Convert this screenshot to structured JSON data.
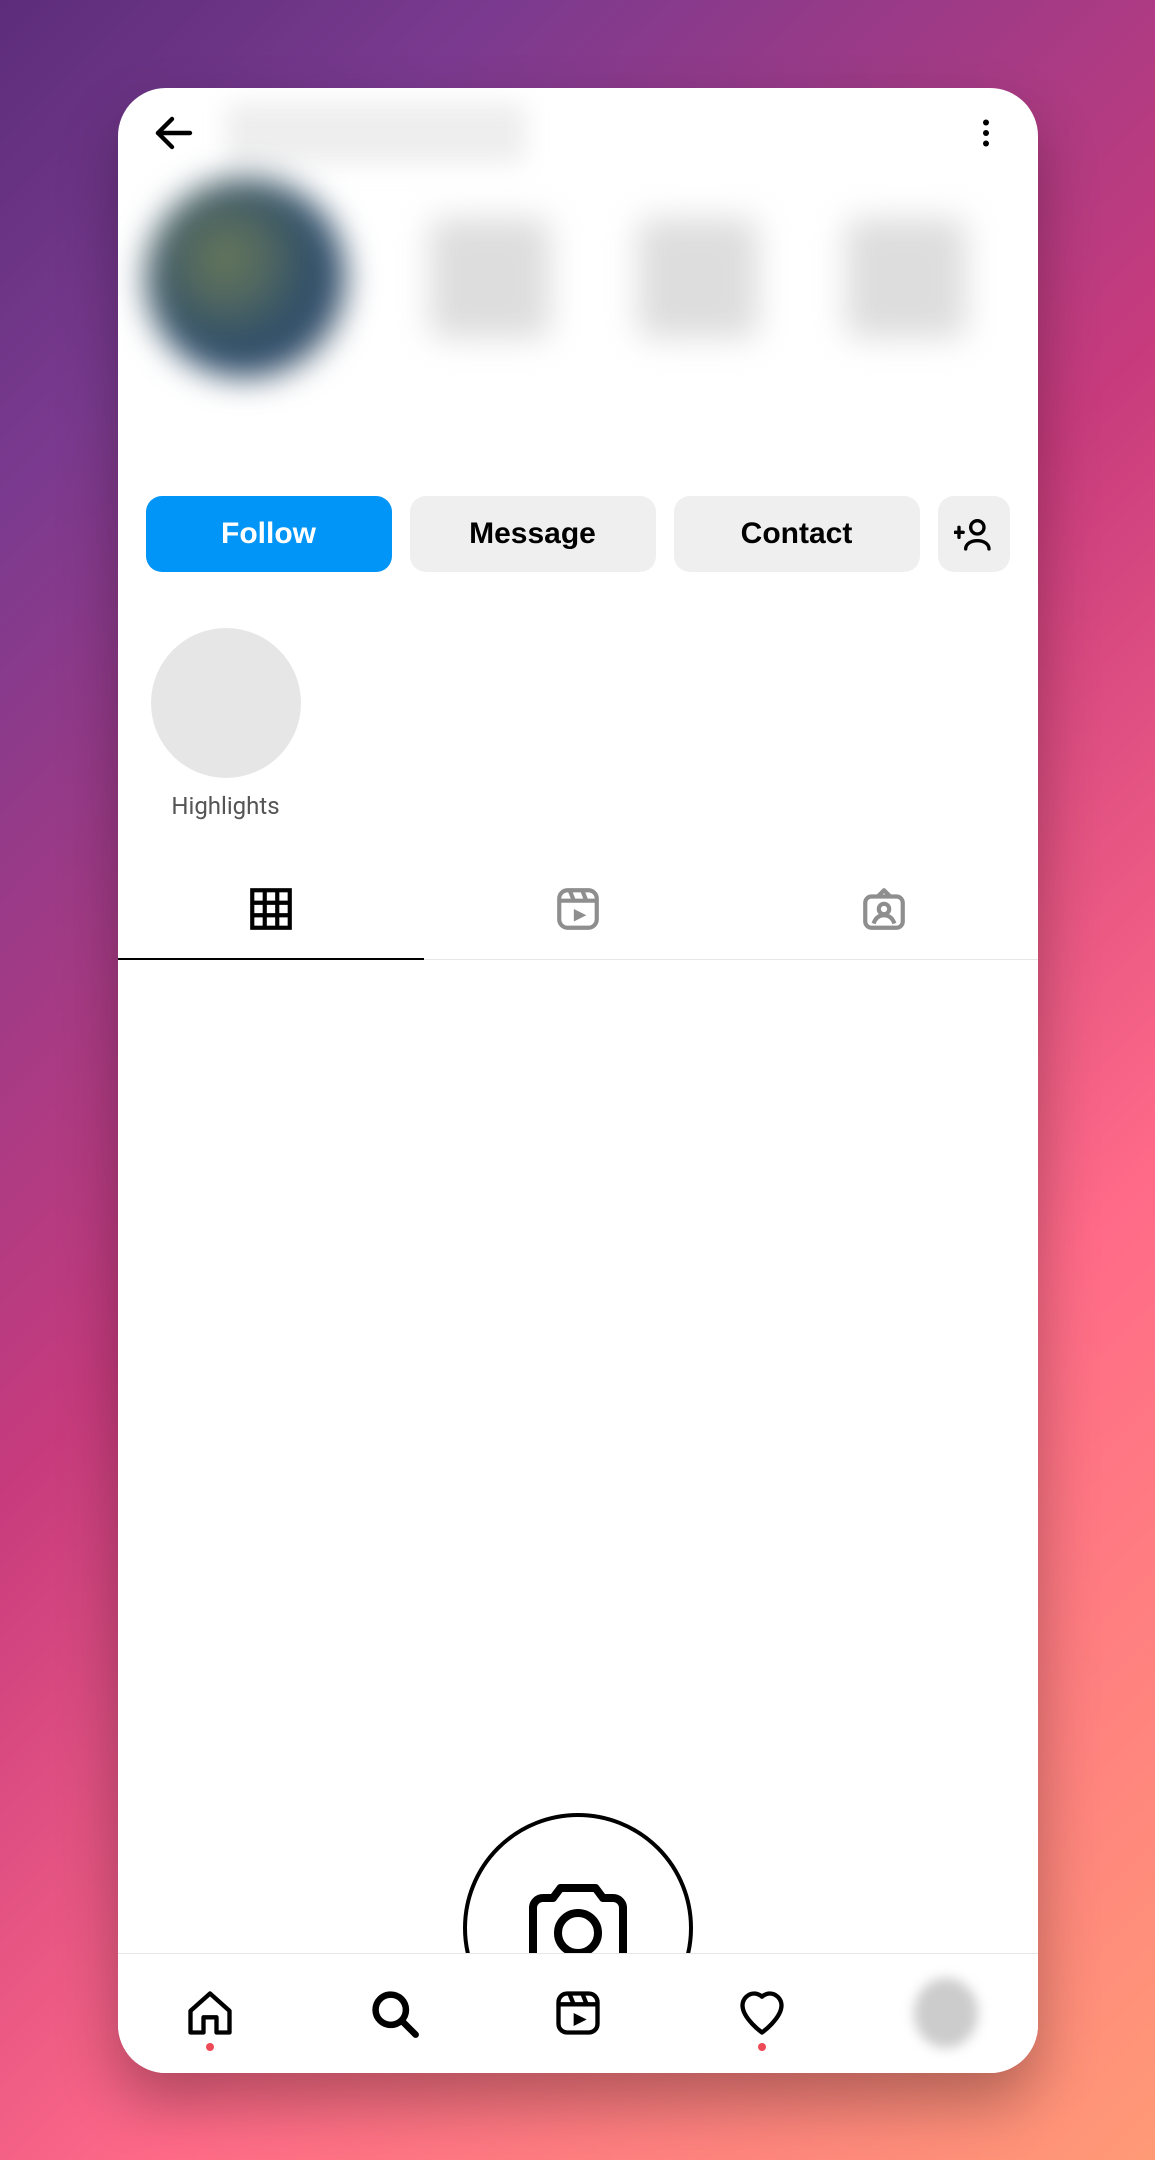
{
  "topbar": {
    "back_icon": "back-arrow",
    "more_icon": "more-vertical"
  },
  "actions": {
    "follow_label": "Follow",
    "message_label": "Message",
    "contact_label": "Contact",
    "add_person_icon": "add-person"
  },
  "highlights": {
    "items": [
      {
        "label": "Highlights"
      }
    ]
  },
  "tabs": {
    "grid_icon": "grid",
    "reels_icon": "reels",
    "tagged_icon": "tagged"
  },
  "camera": {
    "icon": "camera"
  },
  "bottom_nav": {
    "home_icon": "home",
    "search_icon": "search",
    "reels_icon": "reels",
    "activity_icon": "heart",
    "profile_icon": "profile",
    "home_notification": true,
    "activity_notification": true
  }
}
